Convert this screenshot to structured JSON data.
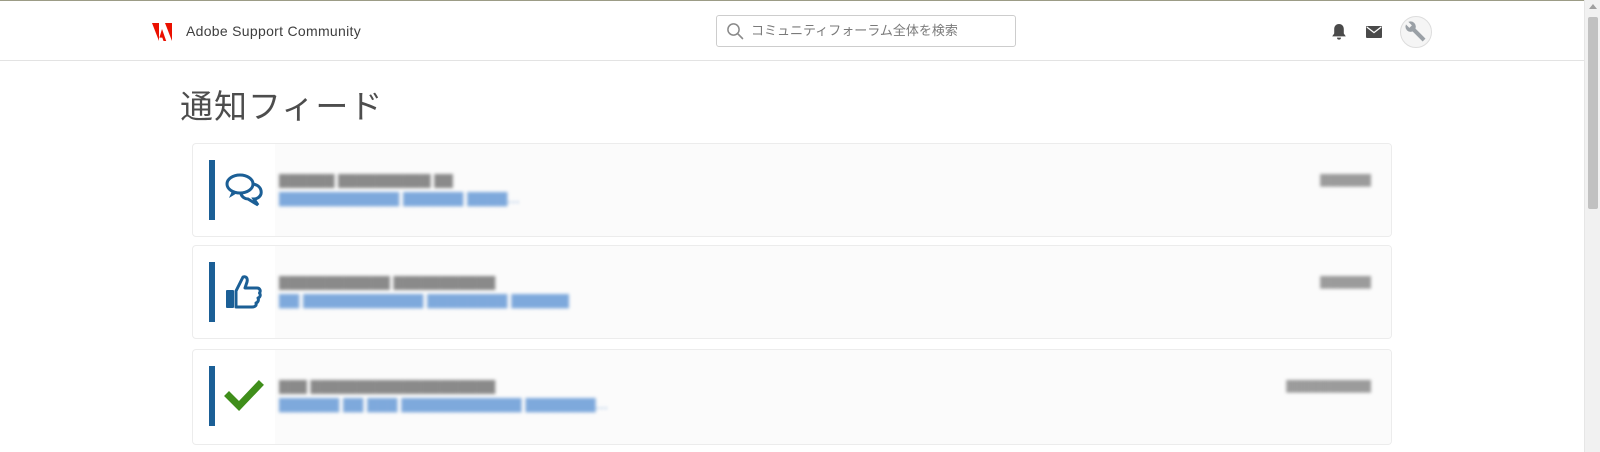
{
  "app": {
    "brand": "Adobe Support Community",
    "brand_color": "#eb1000"
  },
  "search": {
    "placeholder": "コミュニティフォーラム全体を検索"
  },
  "header_icons": [
    "bell-icon",
    "mail-icon",
    "avatar-wrench"
  ],
  "page": {
    "title": "通知フィード"
  },
  "notifications": [
    {
      "type": "reply",
      "icon": "speech-bubbles-icon",
      "icon_color": "#1b5f96",
      "sender": "██████ ██████████ ██",
      "subject": "████████████  ██████ ████...",
      "date": "██████"
    },
    {
      "type": "kudo",
      "icon": "thumbs-up-icon",
      "icon_color": "#1b5f96",
      "sender": "████████████ ███████████",
      "subject": "██ ████████████ ████████ ██████...",
      "date": "██████"
    },
    {
      "type": "solution",
      "icon": "checkmark-icon",
      "icon_color": "#3f8e1a",
      "sender": "███ ████████████████████",
      "subject": "██████ ██ ███ ████████████ ███████...",
      "date": "██████████"
    }
  ]
}
